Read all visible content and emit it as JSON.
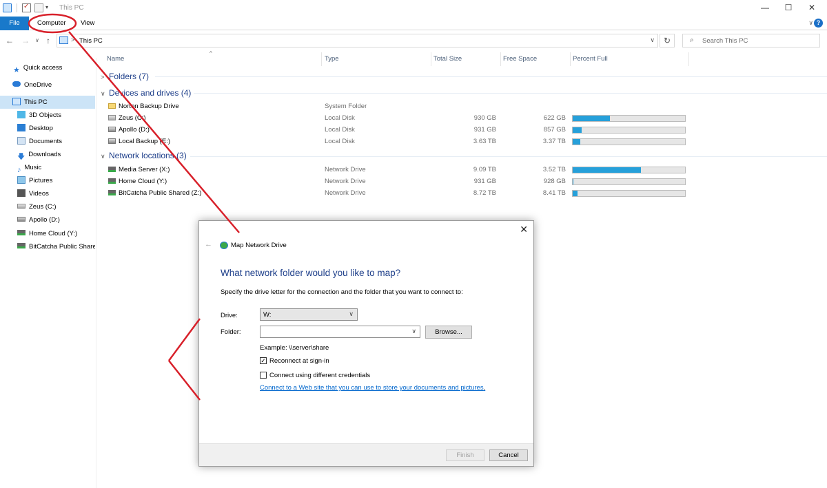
{
  "window": {
    "title": "This PC",
    "controls": {
      "minimize": "—",
      "maximize": "☐",
      "close": "✕"
    }
  },
  "ribbon": {
    "tabs": [
      {
        "label": "File"
      },
      {
        "label": "Computer"
      },
      {
        "label": "View"
      }
    ],
    "expand_glyph": "∨",
    "help_glyph": "?"
  },
  "navigation": {
    "back": "←",
    "forward": "→",
    "recent": "∨",
    "up": "↑",
    "address": "This PC",
    "address_arrow": ">",
    "address_dropdown": "∨",
    "refresh": "↻",
    "search_placeholder": "Search This PC",
    "search_glyph": "⌕"
  },
  "sidebar": {
    "items": [
      {
        "label": "Quick access",
        "icon": "star-icon"
      },
      {
        "label": "OneDrive",
        "icon": "cloud-icon"
      },
      {
        "label": "This PC",
        "icon": "computer-icon",
        "selected": true
      },
      {
        "label": "3D Objects",
        "icon": "3d-objects-icon"
      },
      {
        "label": "Desktop",
        "icon": "desktop-folder-icon"
      },
      {
        "label": "Documents",
        "icon": "documents-folder-icon"
      },
      {
        "label": "Downloads",
        "icon": "download-icon"
      },
      {
        "label": "Music",
        "icon": "music-icon"
      },
      {
        "label": "Pictures",
        "icon": "pictures-folder-icon"
      },
      {
        "label": "Videos",
        "icon": "videos-folder-icon"
      },
      {
        "label": "Zeus (C:)",
        "icon": "windows-drive-icon"
      },
      {
        "label": "Apollo (D:)",
        "icon": "drive-icon"
      },
      {
        "label": "Home Cloud (Y:)",
        "icon": "network-drive-icon"
      },
      {
        "label": "BitCatcha Public Shared (Z:)",
        "icon": "network-drive-icon"
      }
    ]
  },
  "columns": {
    "name": "Name",
    "type": "Type",
    "total_size": "Total Size",
    "free_space": "Free Space",
    "percent_full": "Percent Full",
    "sort_glyph": "^"
  },
  "groups": {
    "folders": {
      "label": "Folders (7)",
      "chevron": ">"
    },
    "devices": {
      "label": "Devices and drives (4)",
      "chevron": "∨"
    },
    "network": {
      "label": "Network locations (3)",
      "chevron": "∨"
    }
  },
  "devices": [
    {
      "name": "Norton Backup Drive",
      "type": "System Folder",
      "total": "",
      "free": "",
      "percent_full": null,
      "icon": "backup-icon"
    },
    {
      "name": "Zeus (C:)",
      "type": "Local Disk",
      "total": "930 GB",
      "free": "622 GB",
      "percent_full": 0.33,
      "icon": "windows-drive-icon"
    },
    {
      "name": "Apollo (D:)",
      "type": "Local Disk",
      "total": "931 GB",
      "free": "857 GB",
      "percent_full": 0.08,
      "icon": "drive-icon"
    },
    {
      "name": "Local Backup (E:)",
      "type": "Local Disk",
      "total": "3.63 TB",
      "free": "3.37 TB",
      "percent_full": 0.07,
      "icon": "drive-icon"
    }
  ],
  "network_locations": [
    {
      "name": "Media Server (X:)",
      "type": "Network Drive",
      "total": "9.09 TB",
      "free": "3.52 TB",
      "percent_full": 0.61,
      "icon": "network-drive-icon"
    },
    {
      "name": "Home Cloud (Y:)",
      "type": "Network Drive",
      "total": "931 GB",
      "free": "928 GB",
      "percent_full": 0.003,
      "icon": "network-drive-icon"
    },
    {
      "name": "BitCatcha Public Shared (Z:)",
      "type": "Network Drive",
      "total": "8.72 TB",
      "free": "8.41 TB",
      "percent_full": 0.04,
      "icon": "network-drive-icon"
    }
  ],
  "dialog": {
    "title": "Map Network Drive",
    "back_glyph": "←",
    "close_glyph": "✕",
    "heading": "What network folder would you like to map?",
    "instruction": "Specify the drive letter for the connection and the folder that you want to connect to:",
    "drive_label": "Drive:",
    "drive_value": "W:",
    "folder_label": "Folder:",
    "folder_value": "",
    "dropdown_glyph": "∨",
    "browse_label": "Browse...",
    "example": "Example: \\\\server\\share",
    "reconnect_label": "Reconnect at sign-in",
    "reconnect_checked": true,
    "credentials_label": "Connect using different credentials",
    "credentials_checked": false,
    "link": "Connect to a Web site that you can use to store your documents and pictures",
    "link_suffix": ".",
    "finish_label": "Finish",
    "cancel_label": "Cancel"
  },
  "annotation": {
    "color": "#d8202a"
  },
  "colors": {
    "accent": "#1979ca",
    "selected": "#cce4f7",
    "bar_fill": "#26a0da",
    "group_heading": "#1e3f8a"
  }
}
